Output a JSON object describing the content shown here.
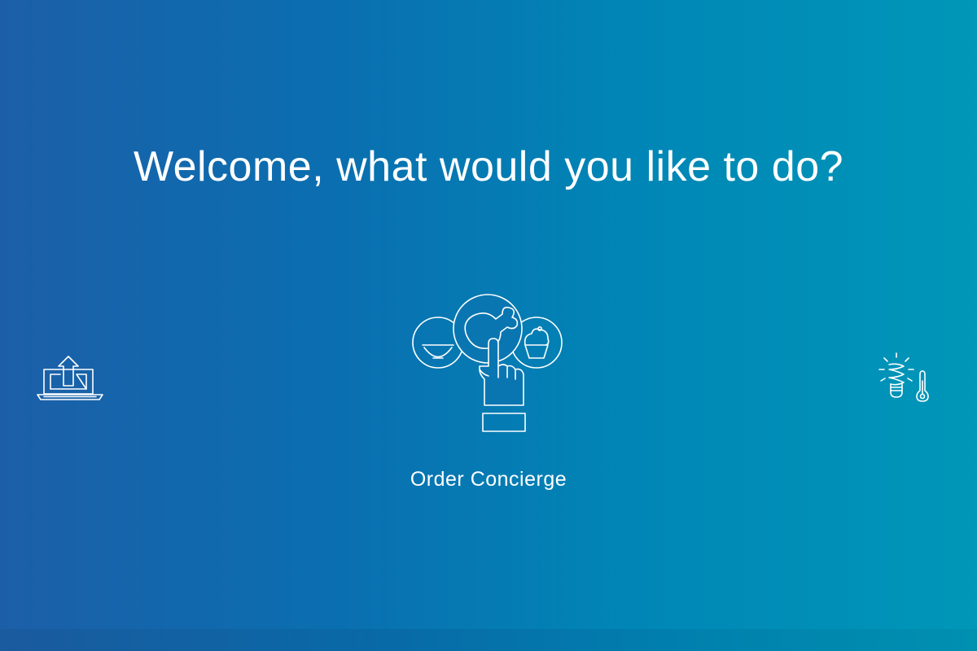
{
  "header": {
    "title": "Welcome, what would you like to do?"
  },
  "options": {
    "left": {
      "icon": "laptop-upload-icon"
    },
    "center": {
      "icon": "food-selection-hand-icon",
      "label": "Order Concierge"
    },
    "right": {
      "icon": "lightbulb-thermometer-icon"
    }
  },
  "colors": {
    "gradient_start": "#1c5fa8",
    "gradient_end": "#0097b8",
    "foreground": "#ffffff"
  }
}
